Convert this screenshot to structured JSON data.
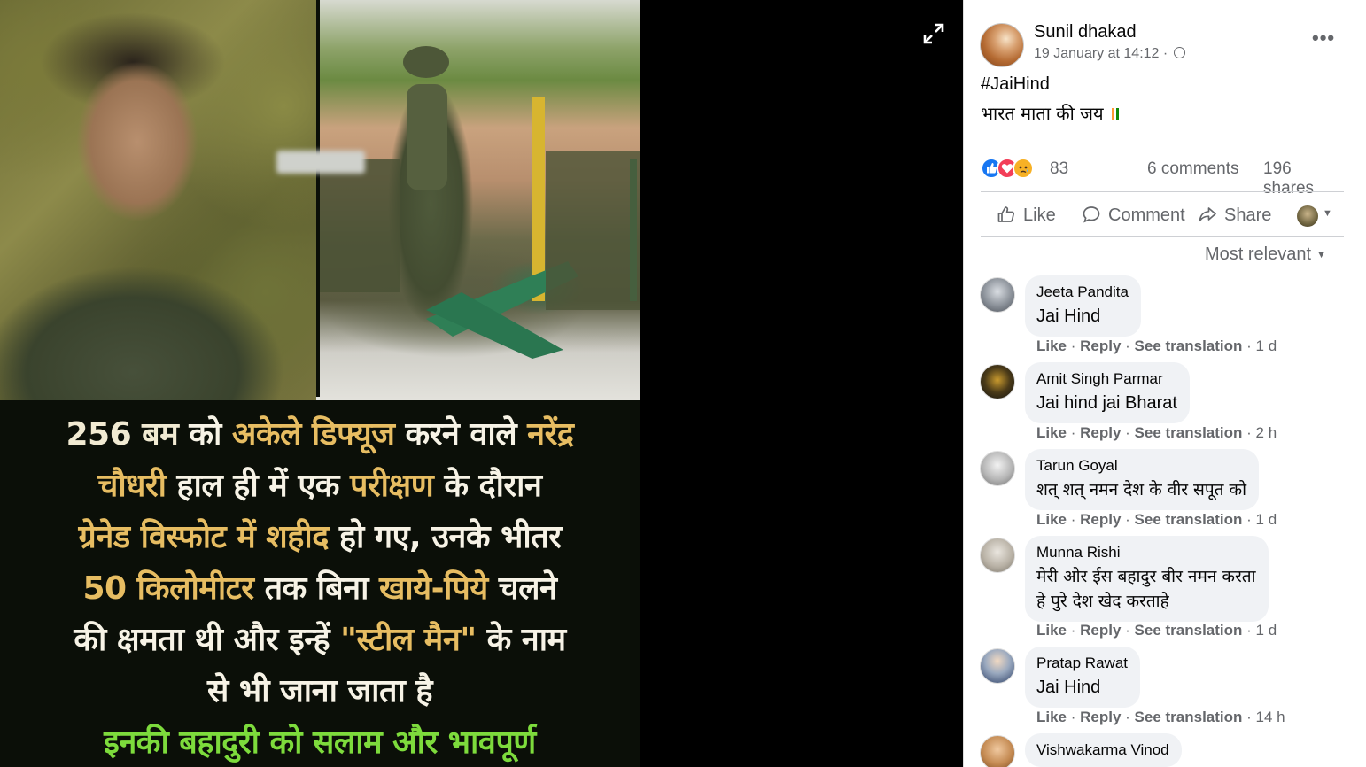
{
  "viewer": {
    "photo_caption": {
      "lines": [
        [
          {
            "t": "256 बम ",
            "c": "#f1ead2"
          },
          {
            "t": "को ",
            "c": "#f7f3e6"
          },
          {
            "t": "अकेले डिफ्यूज ",
            "c": "#e7bd62"
          },
          {
            "t": "करने वाले ",
            "c": "#f7f3e6"
          },
          {
            "t": "नरेंद्र",
            "c": "#e7bd62"
          }
        ],
        [
          {
            "t": "चौधरी ",
            "c": "#e7bd62"
          },
          {
            "t": "हाल ही में एक ",
            "c": "#f7f3e6"
          },
          {
            "t": "परीक्षण ",
            "c": "#e7bd62"
          },
          {
            "t": "के दौरान",
            "c": "#f7f3e6"
          }
        ],
        [
          {
            "t": "ग्रेनेड विस्फोट में शहीद ",
            "c": "#e7bd62"
          },
          {
            "t": "हो गए, उनके भीतर",
            "c": "#f7f3e6"
          }
        ],
        [
          {
            "t": "50 किलोमीटर ",
            "c": "#e7bd62"
          },
          {
            "t": "तक बिना ",
            "c": "#f7f3e6"
          },
          {
            "t": "खाये-पिये ",
            "c": "#e7bd62"
          },
          {
            "t": "चलने",
            "c": "#f7f3e6"
          }
        ],
        [
          {
            "t": "की क्षमता थी और इन्हें ",
            "c": "#f7f3e6"
          },
          {
            "t": "\"स्टील मैन\" ",
            "c": "#e7bd62"
          },
          {
            "t": "के नाम",
            "c": "#f7f3e6"
          }
        ],
        [
          {
            "t": "से भी जाना जाता है",
            "c": "#f7f3e6"
          }
        ],
        [
          {
            "t": "इनकी बहादुरी को सलाम और भावपूर्ण",
            "c": "#7ddb3c"
          }
        ]
      ]
    },
    "expand_icon": "expand-arrows-icon"
  },
  "post": {
    "author": "Sunil dhakad",
    "timestamp": "19 January at 14:12 ·",
    "audience_icon": "globe-icon",
    "hashtag": "#JaiHind",
    "text": "भारत माता की जय",
    "flag_colors": [
      "#ff9933",
      "#ffffff",
      "#138808"
    ],
    "reactions": {
      "icons": [
        "like-reaction-icon",
        "love-reaction-icon",
        "sad-reaction-icon"
      ],
      "count": "83",
      "comments": "6 comments",
      "shares": "196 shares"
    },
    "actions": {
      "like": "Like",
      "comment": "Comment",
      "share": "Share"
    },
    "sort_label": "Most relevant"
  },
  "comments": [
    {
      "name": "Jeeta Pandita",
      "text": "Jai Hind",
      "like": "Like",
      "reply": "Reply",
      "translate": "See translation",
      "time": "1 d"
    },
    {
      "name": "Amit Singh Parmar",
      "text": "Jai hind jai Bharat",
      "like": "Like",
      "reply": "Reply",
      "translate": "See translation",
      "time": "2 h"
    },
    {
      "name": "Tarun Goyal",
      "text": "शत् शत् नमन देश के वीर सपूत को",
      "like": "Like",
      "reply": "Reply",
      "translate": "See translation",
      "time": "1 d"
    },
    {
      "name": "Munna Rishi",
      "text": "मेरी ओर ईस बहादुर बीर नमन करता",
      "text2": "हे पुरे देश खेद करताहे",
      "like": "Like",
      "reply": "Reply",
      "translate": "See translation",
      "time": "1 d"
    },
    {
      "name": "Pratap Rawat",
      "text": "Jai Hind",
      "like": "Like",
      "reply": "Reply",
      "translate": "See translation",
      "time": "14 h"
    },
    {
      "name": "Vishwakarma Vinod"
    }
  ],
  "colors": {
    "link": "#65676b",
    "text": "#050505",
    "bubble": "#f0f2f5",
    "like_blue": "#1877f2"
  }
}
